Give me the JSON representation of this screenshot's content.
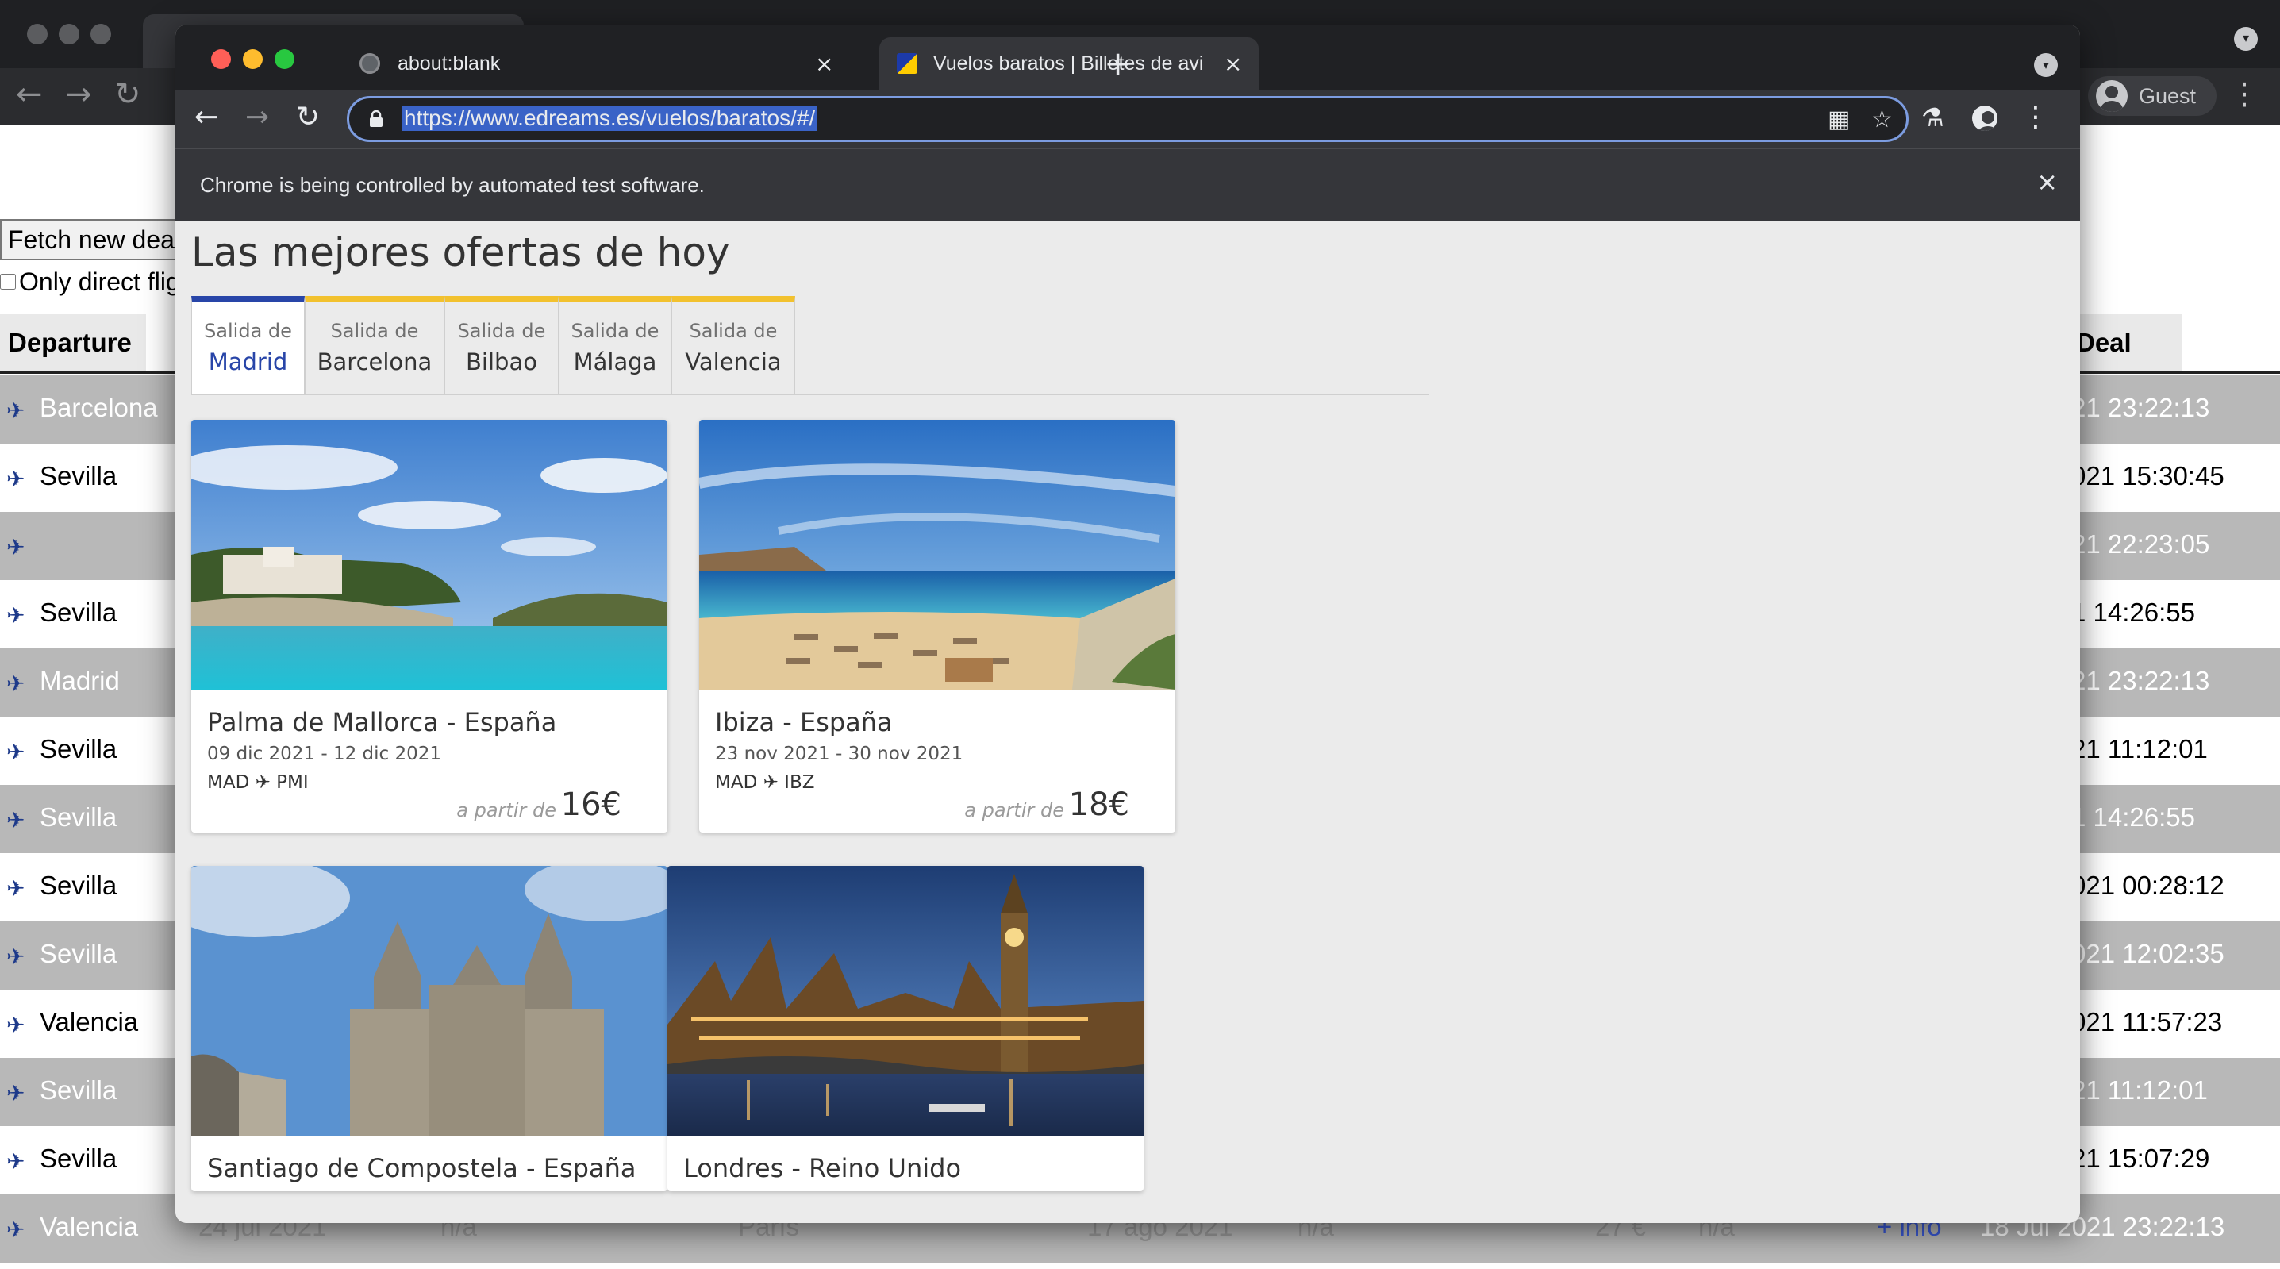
{
  "background_window": {
    "guest_label": "Guest",
    "fetch_button_label": "Fetch new dea",
    "direct_checkbox_label": "Only direct flig",
    "columns": {
      "departure": "Departure",
      "deal": "Deal"
    },
    "rows": [
      {
        "city": "Barcelona",
        "deal_date": "21 23:22:13"
      },
      {
        "city": "Sevilla",
        "deal_date": "021 15:30:45"
      },
      {
        "city": "",
        "deal_date": "21 22:23:05"
      },
      {
        "city": "Sevilla",
        "deal_date": "1 14:26:55"
      },
      {
        "city": "Madrid",
        "deal_date": "21 23:22:13"
      },
      {
        "city": "Sevilla",
        "deal_date": "21 11:12:01"
      },
      {
        "city": "Sevilla",
        "deal_date": "1 14:26:55"
      },
      {
        "city": "Sevilla",
        "deal_date": "021 00:28:12"
      },
      {
        "city": "Sevilla",
        "deal_date": "021 12:02:35"
      },
      {
        "city": "Valencia",
        "deal_date": "021 11:57:23"
      },
      {
        "city": "Sevilla",
        "deal_date": "21 11:12:01"
      },
      {
        "city": "Sevilla",
        "deal_date": "21 15:07:29"
      },
      {
        "city": "Valencia",
        "deal_date": "18 Jul 2021 23:22:13"
      }
    ],
    "last_row_extras": {
      "departure_date": "24 jul 2021",
      "na_1": "n/a",
      "destination": "París",
      "return_date": "17 ago 2021",
      "na_2": "n/a",
      "price": "27 €",
      "na_3": "n/a",
      "info_link": "+ info"
    }
  },
  "browser": {
    "tabs": [
      {
        "title": "about:blank"
      },
      {
        "title": "Vuelos baratos | Billetes de avi"
      }
    ],
    "url": "https://www.edreams.es/vuelos/baratos/#/",
    "infobar_text": "Chrome is being controlled by automated test software."
  },
  "page": {
    "title": "Las mejores ofertas de hoy",
    "tab_prefix": "Salida de",
    "tabs": [
      {
        "city": "Madrid",
        "active": true
      },
      {
        "city": "Barcelona",
        "active": false
      },
      {
        "city": "Bilbao",
        "active": false
      },
      {
        "city": "Málaga",
        "active": false
      },
      {
        "city": "Valencia",
        "active": false
      }
    ],
    "price_prefix": "a partir de",
    "deals": [
      {
        "destination": "Palma de Mallorca - España",
        "dates": "09 dic 2021 - 12 dic 2021",
        "route": "MAD ✈ PMI",
        "price": "16€"
      },
      {
        "destination": "Ibiza - España",
        "dates": "23 nov 2021 - 30 nov 2021",
        "route": "MAD ✈ IBZ",
        "price": "18€"
      },
      {
        "destination": "Santiago de Compostela - España"
      },
      {
        "destination": "Londres - Reino Unido"
      }
    ]
  },
  "colors": {
    "active_tab": "#2845a8",
    "inactive_tab_top": "#f2c12e",
    "chrome_dark": "#202124",
    "chrome_toolbar": "#35363a",
    "url_selection": "#3a63c7"
  },
  "icons": {
    "flight_row": "plane-icon",
    "url_lock": "lock-icon",
    "tab_globe": "globe-icon",
    "tab_edreams": "edreams-favicon-icon"
  }
}
